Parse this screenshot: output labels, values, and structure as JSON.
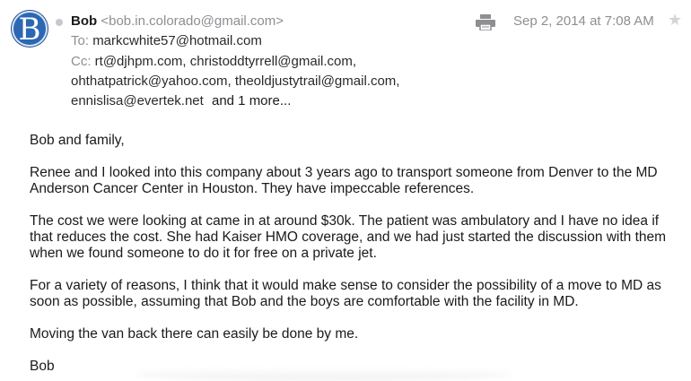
{
  "sender": {
    "avatar_letter": "B",
    "name": "Bob",
    "email": "<bob.in.colorado@gmail.com>"
  },
  "to": {
    "label": "To:",
    "addresses": "markcwhite57@hotmail.com"
  },
  "cc": {
    "label": "Cc:",
    "line1": "rt@djhpm.com,  christoddtyrrell@gmail.com,",
    "line2": "ohthatpatrick@yahoo.com,  theoldjustytrail@gmail.com,",
    "line3": "ennislisa@evertek.net",
    "more": "and 1 more..."
  },
  "date": "Sep 2, 2014 at 7:08 AM",
  "icons": {
    "print": "printer-icon",
    "star": "star-icon",
    "unread_dot": "status-dot-icon"
  },
  "colors": {
    "avatar_bg": "#2c67b3",
    "muted_text": "#8e8e93",
    "body_text": "#1a1a1a"
  },
  "message": {
    "p1": "Bob and family,",
    "p2": "Renee and I looked into this company about 3 years ago to transport someone from Denver to the MD Anderson Cancer Center in Houston. They have impeccable references.",
    "p3": "The cost we were looking at came in at around $30k. The patient was ambulatory and I have no idea if that reduces the cost. She had Kaiser HMO coverage, and we had just started the discussion with them when we found someone to do it for free on a private jet.",
    "p4": "For a variety of reasons, I think that it would make sense to consider the possibility of a move to MD as soon as possible, assuming that Bob and the boys are comfortable with the facility in MD.",
    "p5": "Moving the van back there can easily be done by me.",
    "p6": "Bob"
  }
}
